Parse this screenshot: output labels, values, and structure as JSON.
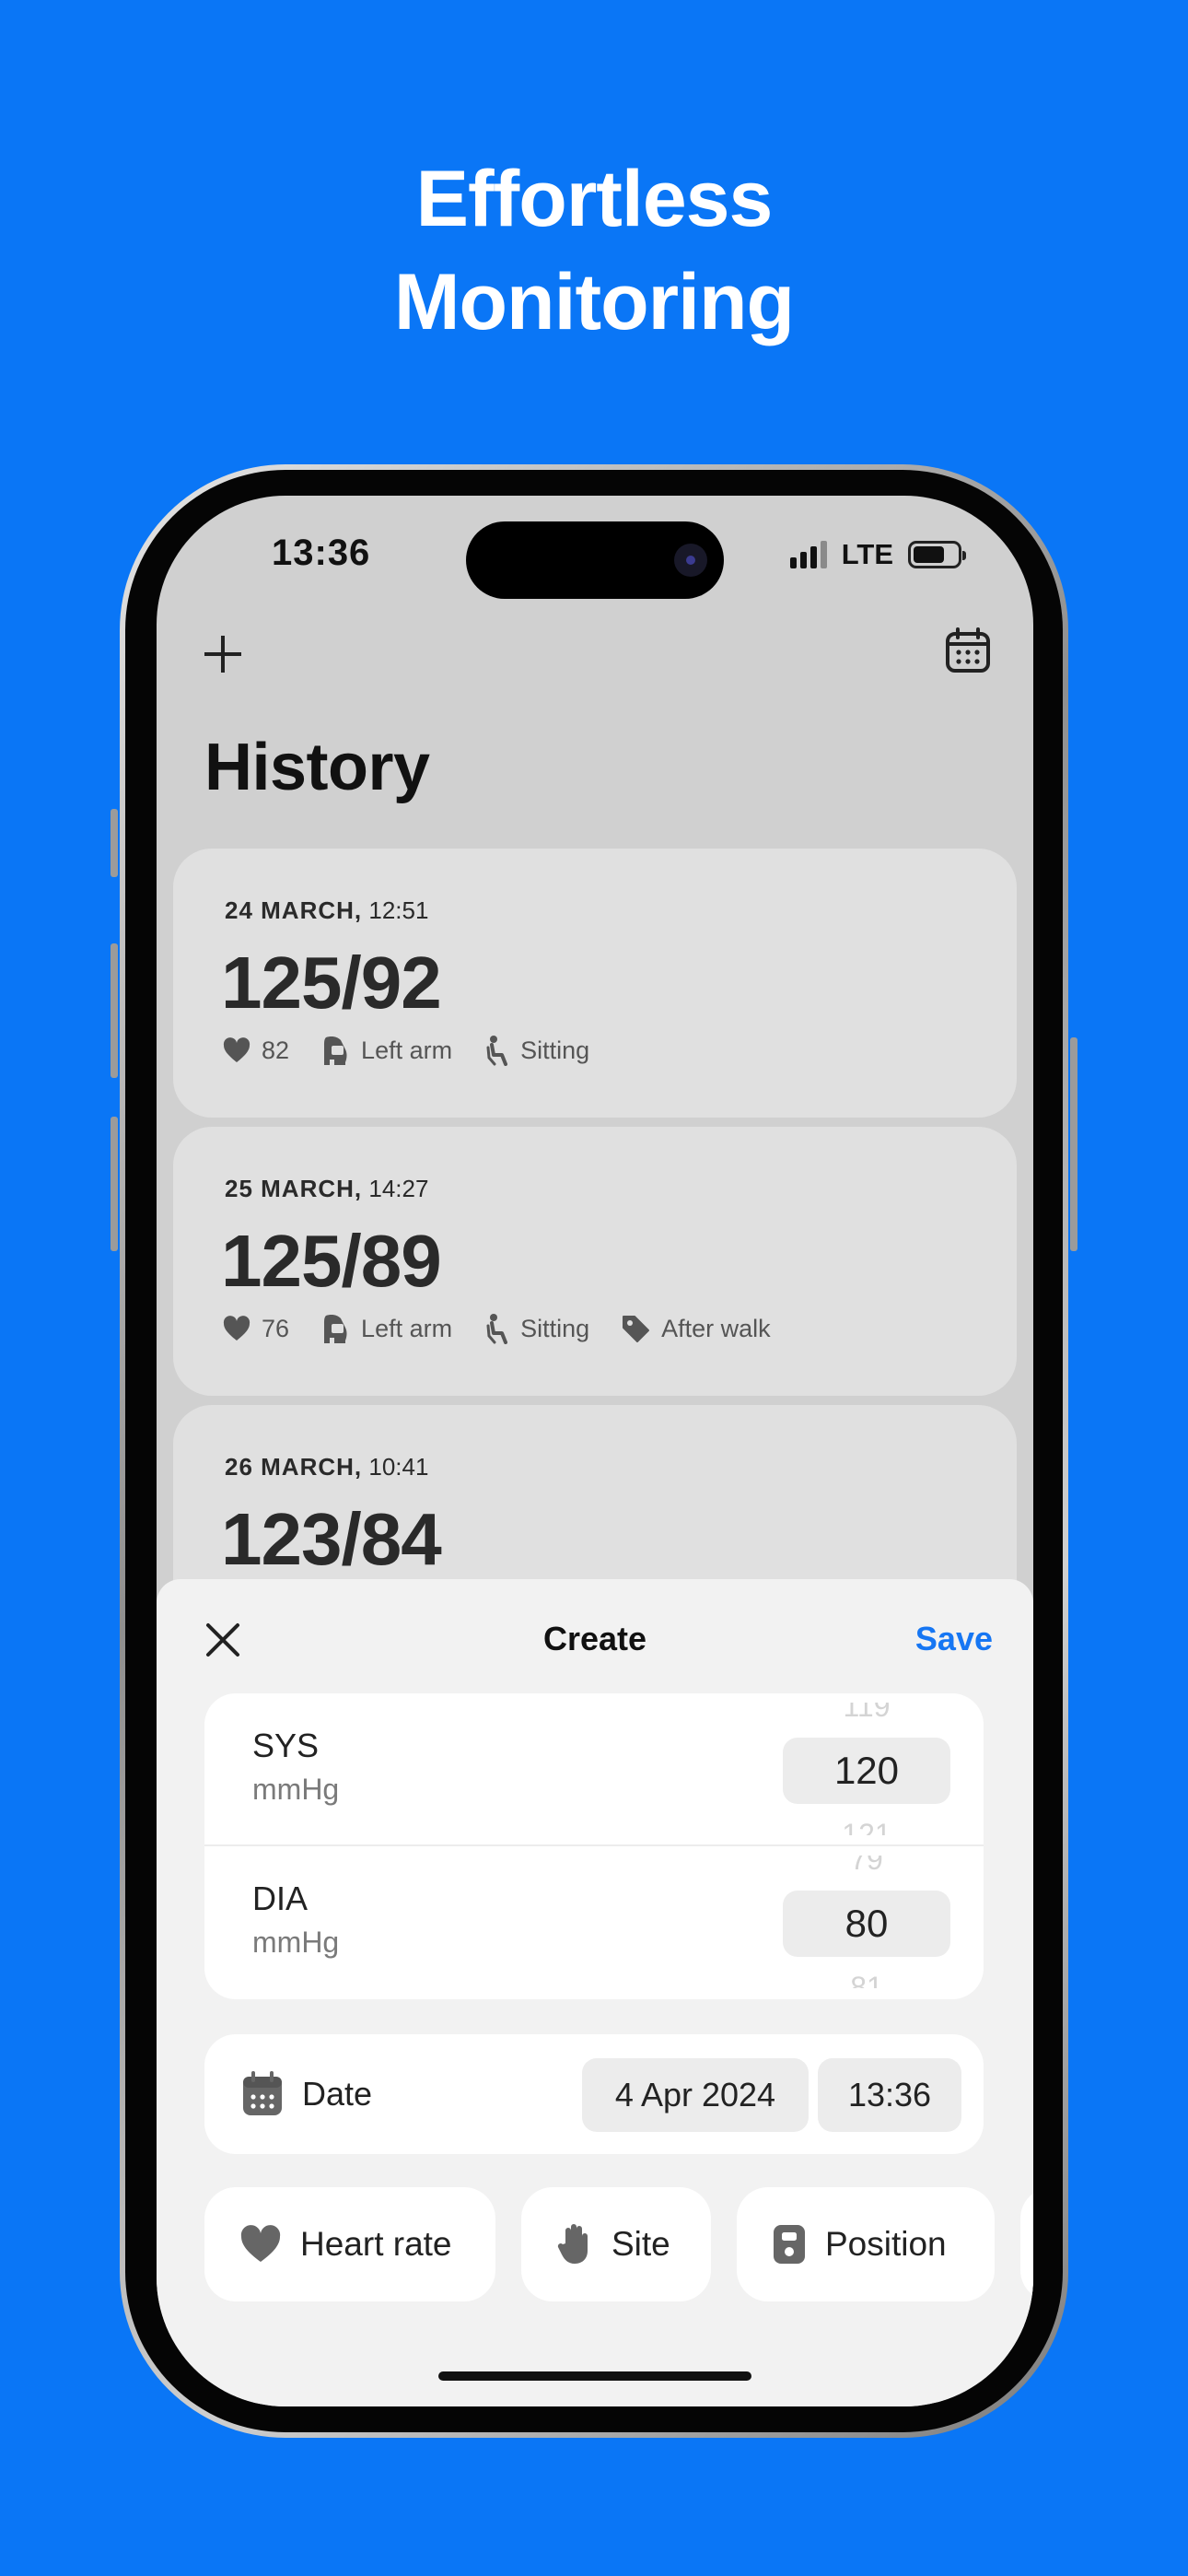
{
  "headline": {
    "line1": "Effortless",
    "line2": "Monitoring"
  },
  "colors": {
    "background": "#0a76f6",
    "accent": "#1676f3"
  },
  "status_bar": {
    "time": "13:36",
    "network": "LTE",
    "battery_icon": "battery-icon",
    "signal_icon": "signal-bars-icon"
  },
  "nav": {
    "add_icon": "plus-icon",
    "calendar_icon": "calendar-icon"
  },
  "history": {
    "title": "History",
    "entries": [
      {
        "date": "24 MARCH,",
        "time": "12:51",
        "reading": "125/92",
        "pulse": "82",
        "site": "Left arm",
        "position": "Sitting",
        "tag": ""
      },
      {
        "date": "25 MARCH,",
        "time": "14:27",
        "reading": "125/89",
        "pulse": "76",
        "site": "Left arm",
        "position": "Sitting",
        "tag": "After walk"
      },
      {
        "date": "26 MARCH,",
        "time": "10:41",
        "reading": "123/84"
      }
    ]
  },
  "sheet": {
    "close_icon": "close-icon",
    "title": "Create",
    "save_label": "Save",
    "sys": {
      "label": "SYS",
      "unit": "mmHg",
      "value": "120",
      "above": "119",
      "below": "121"
    },
    "dia": {
      "label": "DIA",
      "unit": "mmHg",
      "value": "80",
      "above": "79",
      "below": "81"
    },
    "date_row": {
      "label": "Date",
      "date": "4 Apr 2024",
      "time": "13:36"
    },
    "chips": {
      "heart_rate": "Heart rate",
      "site": "Site",
      "position": "Position"
    }
  }
}
